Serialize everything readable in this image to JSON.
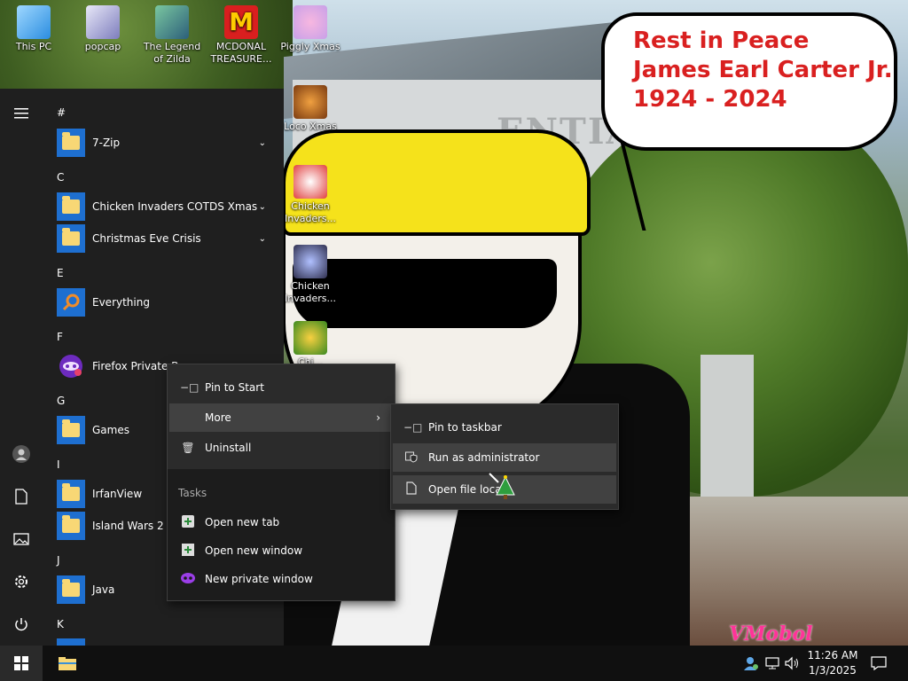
{
  "desktop": {
    "icons": [
      {
        "label": "This PC"
      },
      {
        "label": "popcap"
      },
      {
        "label": "The Legend\nof Zilda"
      },
      {
        "label": "MCDONAL\nTREASURE..."
      },
      {
        "label": "Piggly Xmas"
      },
      {
        "label": "Loco Xmas"
      },
      {
        "label": "Chicken\nInvaders..."
      },
      {
        "label": "Chicken\nInvaders..."
      },
      {
        "label": "Chi..."
      }
    ]
  },
  "wallpaper": {
    "bubble_lines": [
      "Rest in Peace",
      "James Earl Carter Jr.",
      "1924 - 2024"
    ],
    "building_sign": "ENTIAL",
    "watermark": "VMobol",
    "bubble_color": "#d92020"
  },
  "start_menu": {
    "rail": {
      "icons": [
        "hamburger-icon",
        "user-icon",
        "documents-icon",
        "pictures-icon",
        "settings-icon",
        "power-icon"
      ]
    },
    "groups": [
      {
        "letter": "#",
        "apps": [
          {
            "label": "7-Zip",
            "expandable": true
          }
        ]
      },
      {
        "letter": "C",
        "apps": [
          {
            "label": "Chicken Invaders COTDS Xmas",
            "expandable": true
          },
          {
            "label": "Christmas Eve Crisis",
            "expandable": true
          }
        ]
      },
      {
        "letter": "E",
        "apps": [
          {
            "label": "Everything",
            "expandable": false
          }
        ]
      },
      {
        "letter": "F",
        "apps": [
          {
            "label": "Firefox Private B",
            "expandable": false
          }
        ]
      },
      {
        "letter": "G",
        "apps": [
          {
            "label": "Games",
            "expandable": false
          }
        ]
      },
      {
        "letter": "I",
        "apps": [
          {
            "label": "IrfanView",
            "expandable": false
          },
          {
            "label": "Island Wars 2 Xr",
            "expandable": false
          }
        ]
      },
      {
        "letter": "J",
        "apps": [
          {
            "label": "Java",
            "expandable": false
          }
        ]
      },
      {
        "letter": "K",
        "apps": []
      }
    ]
  },
  "context_menu": {
    "pin_to_start": "Pin to Start",
    "more": "More",
    "uninstall": "Uninstall",
    "tasks_label": "Tasks",
    "open_new_tab": "Open new tab",
    "open_new_window": "Open new window",
    "new_private_window": "New private window"
  },
  "submenu": {
    "pin_to_taskbar": "Pin to taskbar",
    "run_as_admin": "Run as administrator",
    "open_file_location": "Open file locati"
  },
  "taskbar": {
    "time": "11:26 AM",
    "date": "1/3/2025"
  }
}
